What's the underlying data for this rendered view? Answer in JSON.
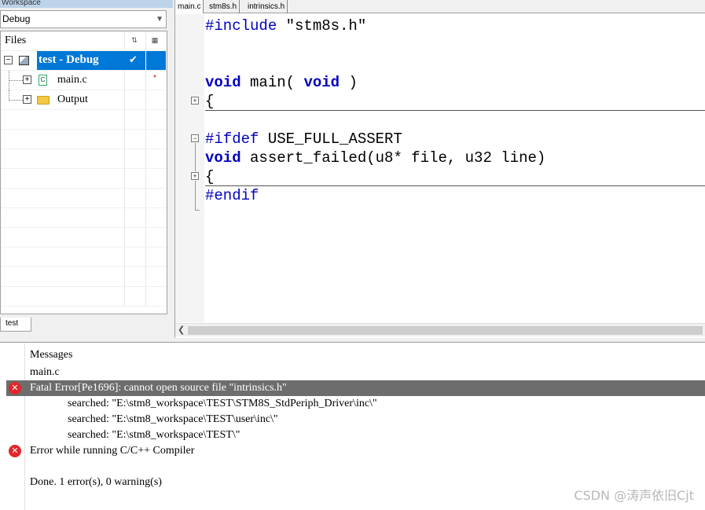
{
  "workspace": {
    "title": "Workspace",
    "config": "Debug",
    "files_header": "Files",
    "project_label": "test - Debug",
    "items": [
      {
        "label": "main.c",
        "modified": "*"
      },
      {
        "label": "Output"
      }
    ],
    "bottom_tab": "test"
  },
  "editor": {
    "tabs": [
      "main.c",
      "stm8s.h",
      "intrinsics.h"
    ],
    "code": {
      "l1_pp": "#include",
      "l1_str": " \"stm8s.h\"",
      "l4_kw1": "void",
      "l4_mid": " main( ",
      "l4_kw2": "void",
      "l4_end": " )",
      "l5": "{",
      "l7_pp": "#ifdef",
      "l7_rest": " USE_FULL_ASSERT",
      "l8_kw": "void",
      "l8_rest": " assert_failed(u8* file, u32 line)",
      "l9": "{",
      "l10_pp": "#endif"
    }
  },
  "messages": {
    "header": "Messages",
    "file": "main.c",
    "fatal": "Fatal Error[Pe1696]: cannot open source file \"intrinsics.h\"",
    "searched": [
      "searched: \"E:\\stm8_workspace\\TEST\\STM8S_StdPeriph_Driver\\inc\\\"",
      "searched: \"E:\\stm8_workspace\\TEST\\user\\inc\\\"",
      "searched: \"E:\\stm8_workspace\\TEST\\\""
    ],
    "error_running": "Error while running C/C++ Compiler",
    "done": "Done. 1 error(s), 0 warning(s)"
  },
  "watermark": "CSDN @涛声依旧Cjt",
  "colors": {
    "selection": "#0078d7",
    "keyword": "#0000c0",
    "error": "#e2262b",
    "selected_message": "#6d6d6d"
  },
  "icons": [
    "project-icon",
    "c-file-icon",
    "folder-icon",
    "error-icon",
    "checkmark-icon"
  ]
}
